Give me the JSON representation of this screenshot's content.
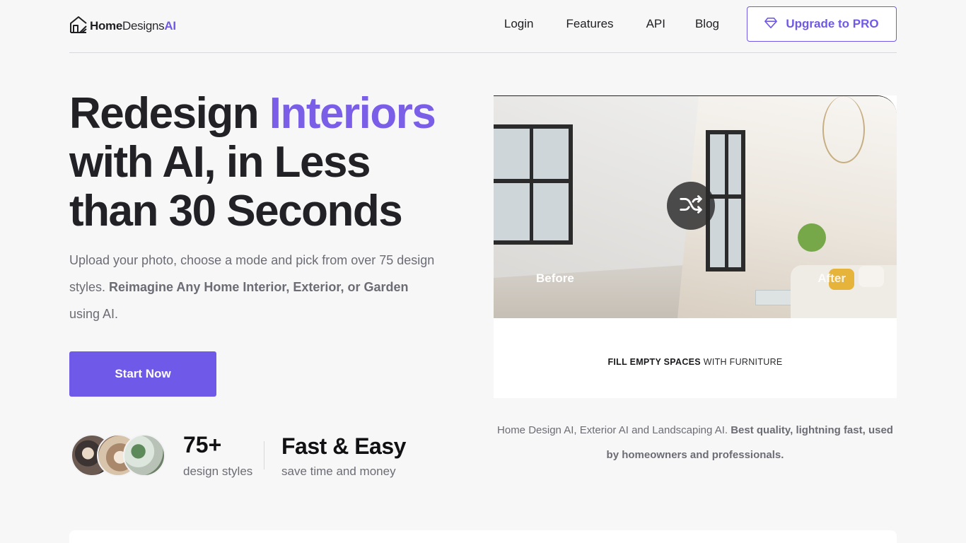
{
  "header": {
    "logo": {
      "home": "Home",
      "designs": "Designs",
      "ai": "AI",
      "icon": "house-icon"
    },
    "nav": [
      {
        "label": "Login"
      },
      {
        "label": "Features"
      },
      {
        "label": "API"
      },
      {
        "label": "Blog"
      }
    ],
    "upgrade": {
      "label": "Upgrade to PRO",
      "icon": "diamond-icon"
    }
  },
  "hero": {
    "title_part1": "Redesign ",
    "title_accent": "Interiors",
    "title_part2": "with AI, in Less than 30 Seconds",
    "subtitle_part1": "Upload your photo, choose a mode and pick from over 75 design styles. ",
    "subtitle_bold": "Reimagine Any Home Interior, Exterior, or Garden",
    "subtitle_part2": " using AI.",
    "cta_label": "Start Now",
    "stats": [
      {
        "value": "75+",
        "label": "design styles"
      },
      {
        "value": "Fast & Easy",
        "label": "save time and money"
      }
    ]
  },
  "compare": {
    "before_label": "Before",
    "after_label": "After",
    "shuffle_icon": "shuffle-icon",
    "caption_bold": "FILL EMPTY SPACES",
    "caption_rest": " WITH FURNITURE"
  },
  "description": {
    "text_part1": "Home Design AI, Exterior AI and Landscaping AI. ",
    "text_bold": "Best quality, lightning fast, used by homeowners and professionals."
  },
  "colors": {
    "accent": "#6f59e8",
    "title_accent": "#7a5ee8",
    "background": "#f7f7f8",
    "text_muted": "#6c6c74"
  }
}
